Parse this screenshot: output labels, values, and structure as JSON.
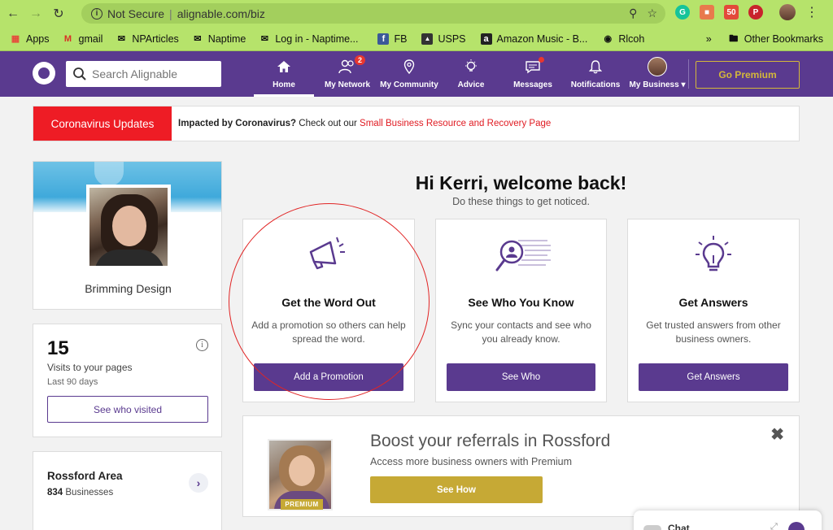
{
  "browser": {
    "security_label": "Not Secure",
    "url": "alignable.com/biz",
    "bookmarks": [
      {
        "label": "Apps",
        "icon": "apps-grid-icon"
      },
      {
        "label": "gmail",
        "icon": "gmail-icon"
      },
      {
        "label": "NPArticles",
        "icon": "envelope-icon"
      },
      {
        "label": "Naptime",
        "icon": "envelope-icon"
      },
      {
        "label": "Log in - Naptime...",
        "icon": "envelope-icon"
      },
      {
        "label": "FB",
        "icon": "facebook-icon"
      },
      {
        "label": "USPS",
        "icon": "usps-icon"
      },
      {
        "label": "Amazon Music - B...",
        "icon": "amazon-icon"
      },
      {
        "label": "Rlcoh",
        "icon": "globe-icon"
      }
    ],
    "overflow_label": "»",
    "other_bookmarks": "Other Bookmarks"
  },
  "header": {
    "search_placeholder": "Search Alignable",
    "nav": [
      {
        "label": "Home",
        "icon": "home-icon"
      },
      {
        "label": "My Network",
        "icon": "people-icon",
        "badge": "2"
      },
      {
        "label": "My Community",
        "icon": "map-pin-icon"
      },
      {
        "label": "Advice",
        "icon": "lightbulb-icon"
      },
      {
        "label": "Messages",
        "icon": "chat-bubble-icon"
      },
      {
        "label": "Notifications",
        "icon": "bell-icon"
      },
      {
        "label": "My Business ▾",
        "icon": "avatar"
      }
    ],
    "premium_label": "Go Premium"
  },
  "banner": {
    "tag": "Coronavirus Updates",
    "bold": "Impacted by Coronavirus?",
    "text": " Check out our ",
    "link": "Small Business Resource and Recovery Page"
  },
  "profile": {
    "name": "Brimming Design"
  },
  "visits": {
    "count": "15",
    "label": "Visits to your pages",
    "period": "Last 90 days",
    "button": "See who visited"
  },
  "area": {
    "title": "Rossford Area",
    "count": "834",
    "count_label": " Businesses"
  },
  "welcome": {
    "title": "Hi Kerri, welcome back!",
    "subtitle": "Do these things to get noticed."
  },
  "tasks": [
    {
      "title": "Get the Word Out",
      "desc": "Add a promotion so others can help spread the word.",
      "button": "Add a Promotion",
      "icon": "megaphone-icon"
    },
    {
      "title": "See Who You Know",
      "desc": "Sync your contacts and see who you already know.",
      "button": "See Who",
      "icon": "contact-search-icon"
    },
    {
      "title": "Get Answers",
      "desc": "Get trusted answers from other business owners.",
      "button": "Get Answers",
      "icon": "lightbulb-icon"
    }
  ],
  "boost": {
    "title": "Boost your referrals in Rossford",
    "subtitle": "Access more business owners with Premium",
    "button": "See How",
    "badge": "PREMIUM"
  },
  "chat": {
    "label": "Chat"
  },
  "colors": {
    "brand": "#5a3a8f",
    "gold": "#c6a935",
    "alert": "#ee1c25",
    "chrome": "#b6e36b"
  }
}
